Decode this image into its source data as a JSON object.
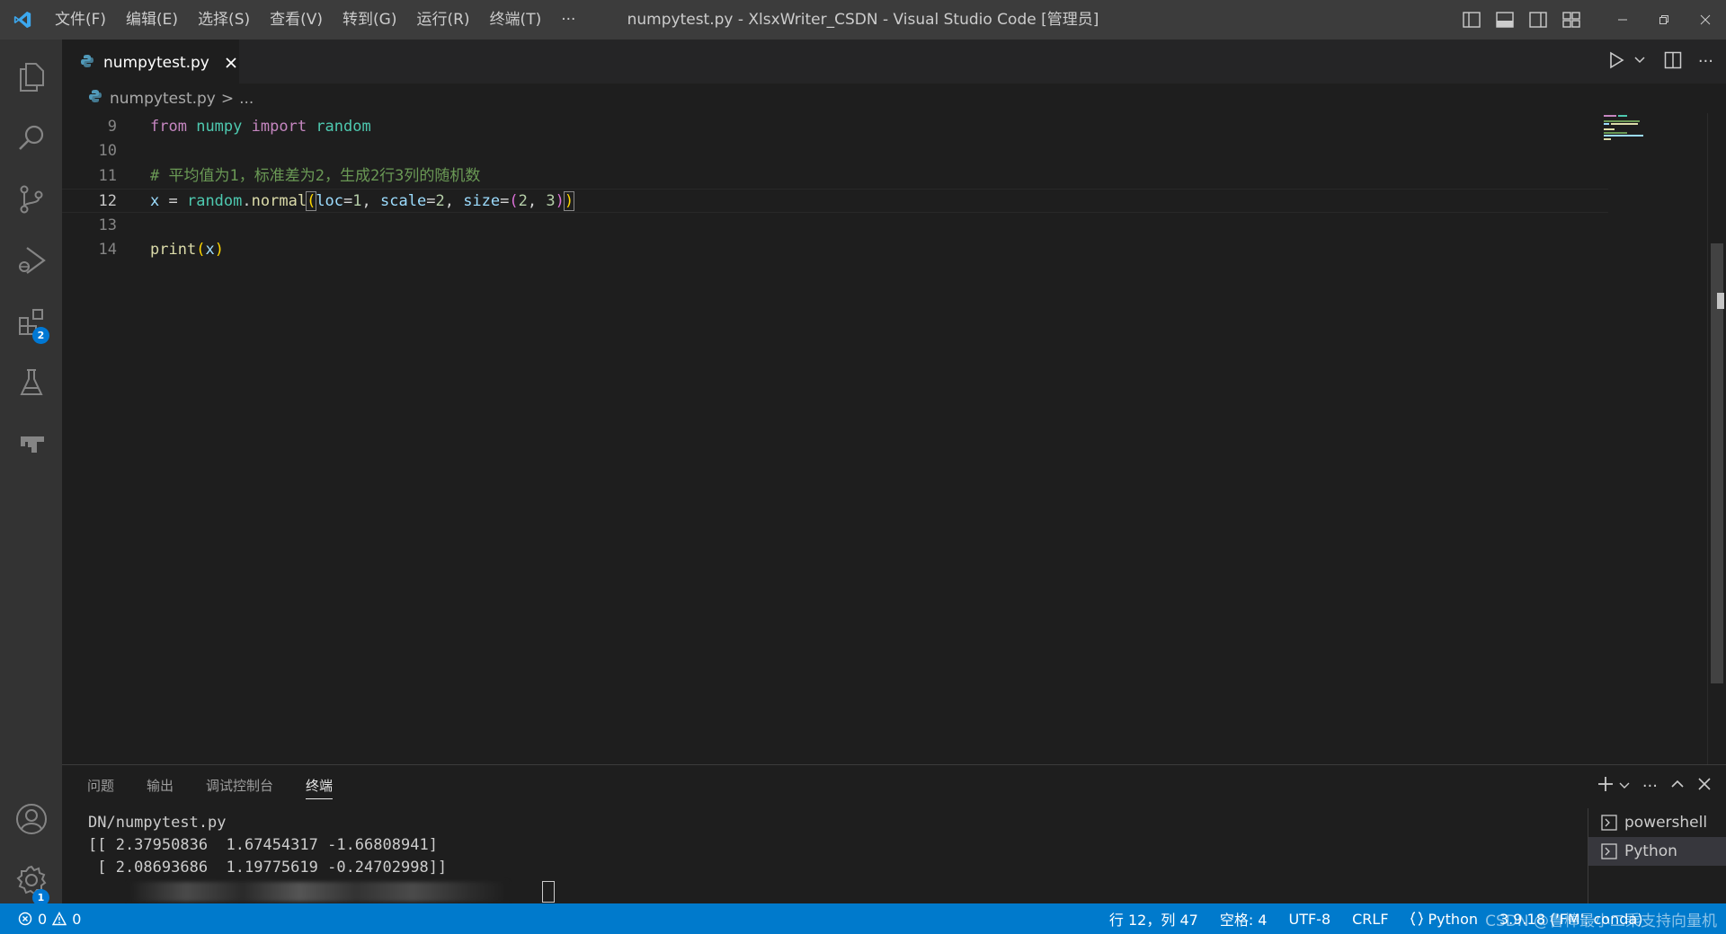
{
  "titlebar": {
    "menu": [
      "文件(F)",
      "编辑(E)",
      "选择(S)",
      "查看(V)",
      "转到(G)",
      "运行(R)",
      "终端(T)",
      "···"
    ],
    "window_title": "numpytest.py - XlsxWriter_CSDN - Visual Studio Code [管理员]",
    "icons": [
      "toggle-primary-sidebar-icon",
      "toggle-panel-icon",
      "toggle-secondary-sidebar-icon",
      "customize-layout-icon"
    ],
    "window_controls": [
      "minimize",
      "restore",
      "close"
    ]
  },
  "activitybar": {
    "items": [
      "explorer",
      "search",
      "source-control",
      "run-and-debug",
      "extensions",
      "testing",
      "remote"
    ],
    "extensions_badge": "2",
    "settings_badge": "1"
  },
  "tab": {
    "label": "numpytest.py"
  },
  "breadcrumb": {
    "file": "numpytest.py",
    "sep": ">",
    "rest": "..."
  },
  "editor": {
    "lines": [
      {
        "n": "9",
        "tokens": [
          [
            "kw",
            "from"
          ],
          [
            "op",
            " "
          ],
          [
            "mod",
            "numpy"
          ],
          [
            "op",
            " "
          ],
          [
            "kw",
            "import"
          ],
          [
            "op",
            " "
          ],
          [
            "mod",
            "random"
          ]
        ]
      },
      {
        "n": "10",
        "tokens": []
      },
      {
        "n": "11",
        "tokens": [
          [
            "cm",
            "# 平均值为1，标准差为2，生成2行3列的随机数"
          ]
        ]
      },
      {
        "n": "12",
        "tokens": [
          [
            "id",
            "x"
          ],
          [
            "op",
            " = "
          ],
          [
            "mod",
            "random"
          ],
          [
            "op",
            "."
          ],
          [
            "fn",
            "normal"
          ],
          [
            "br1",
            "("
          ],
          [
            "id",
            "loc"
          ],
          [
            "op",
            "="
          ],
          [
            "num",
            "1"
          ],
          [
            "op",
            ", "
          ],
          [
            "id",
            "scale"
          ],
          [
            "op",
            "="
          ],
          [
            "num",
            "2"
          ],
          [
            "op",
            ", "
          ],
          [
            "id",
            "size"
          ],
          [
            "op",
            "="
          ],
          [
            "br2",
            "("
          ],
          [
            "num",
            "2"
          ],
          [
            "op",
            ", "
          ],
          [
            "num",
            "3"
          ],
          [
            "br2",
            ")"
          ],
          [
            "br1",
            ")"
          ]
        ],
        "current": true
      },
      {
        "n": "13",
        "tokens": []
      },
      {
        "n": "14",
        "tokens": [
          [
            "fn",
            "print"
          ],
          [
            "br1",
            "("
          ],
          [
            "id",
            "x"
          ],
          [
            "br1",
            ")"
          ]
        ]
      }
    ]
  },
  "panel": {
    "tabs": [
      "问题",
      "输出",
      "调试控制台",
      "终端"
    ],
    "active_tab": "终端",
    "terminal_lines": [
      "DN/numpytest.py",
      "[[ 2.37950836  1.67454317 -1.66808941]",
      " [ 2.08693686  1.19775619 -0.24702998]]"
    ],
    "terminals": [
      "powershell",
      "Python"
    ],
    "active_terminal": "Python"
  },
  "statusbar": {
    "errors": "0",
    "warnings": "0",
    "position": "行 12，列 47",
    "spaces": "空格: 4",
    "encoding": "UTF-8",
    "eol": "CRLF",
    "language": "Python",
    "interpreter": "3.9.18 ('FM': conda)",
    "watermark": "CSDN @鲁棒最小二乘支持向量机"
  },
  "colors": {
    "accent": "#007acc",
    "badge": "#0078d4",
    "titlebar": "#3c3c3c",
    "activitybar": "#333333",
    "editor_bg": "#1e1e1e"
  }
}
